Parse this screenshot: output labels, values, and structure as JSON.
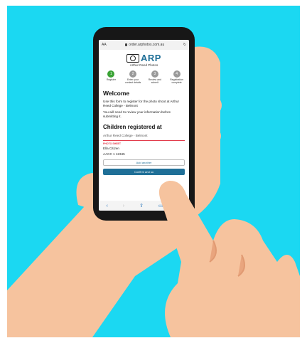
{
  "browser": {
    "text_size": "AA",
    "url": "order.arphotos.com.au",
    "reload_icon": "reload-icon",
    "toolbar_icons": [
      "back-icon",
      "forward-icon",
      "share-icon",
      "bookmarks-icon",
      "tabs-icon"
    ]
  },
  "brand": {
    "logo_text": "ARP",
    "logo_sub": "Arthur Reed Photos",
    "accent": "#1f6f97",
    "step_active": "#3aa335",
    "photo_sheet_color": "#e23a4a"
  },
  "steps": [
    {
      "num": "1",
      "label": "Register",
      "active": true
    },
    {
      "num": "2",
      "label": "Enter your contact details",
      "active": false
    },
    {
      "num": "3",
      "label": "Review and submit",
      "active": false
    },
    {
      "num": "4",
      "label": "Registration complete",
      "active": false
    }
  ],
  "welcome": {
    "title": "Welcome",
    "text1": "Use this form to register for the photo shoot at Arthur Reed College - Belmont",
    "text2": "You will need to review your information before submitting it."
  },
  "children": {
    "title": "Children registered at",
    "school": "Arthur Reed College - Belmont",
    "tag": "PHOTO SHEET",
    "name": "Ella Citizen",
    "id": "AACC 1 12345",
    "add_button": "Add another",
    "continue_button": "Confirm and su"
  }
}
